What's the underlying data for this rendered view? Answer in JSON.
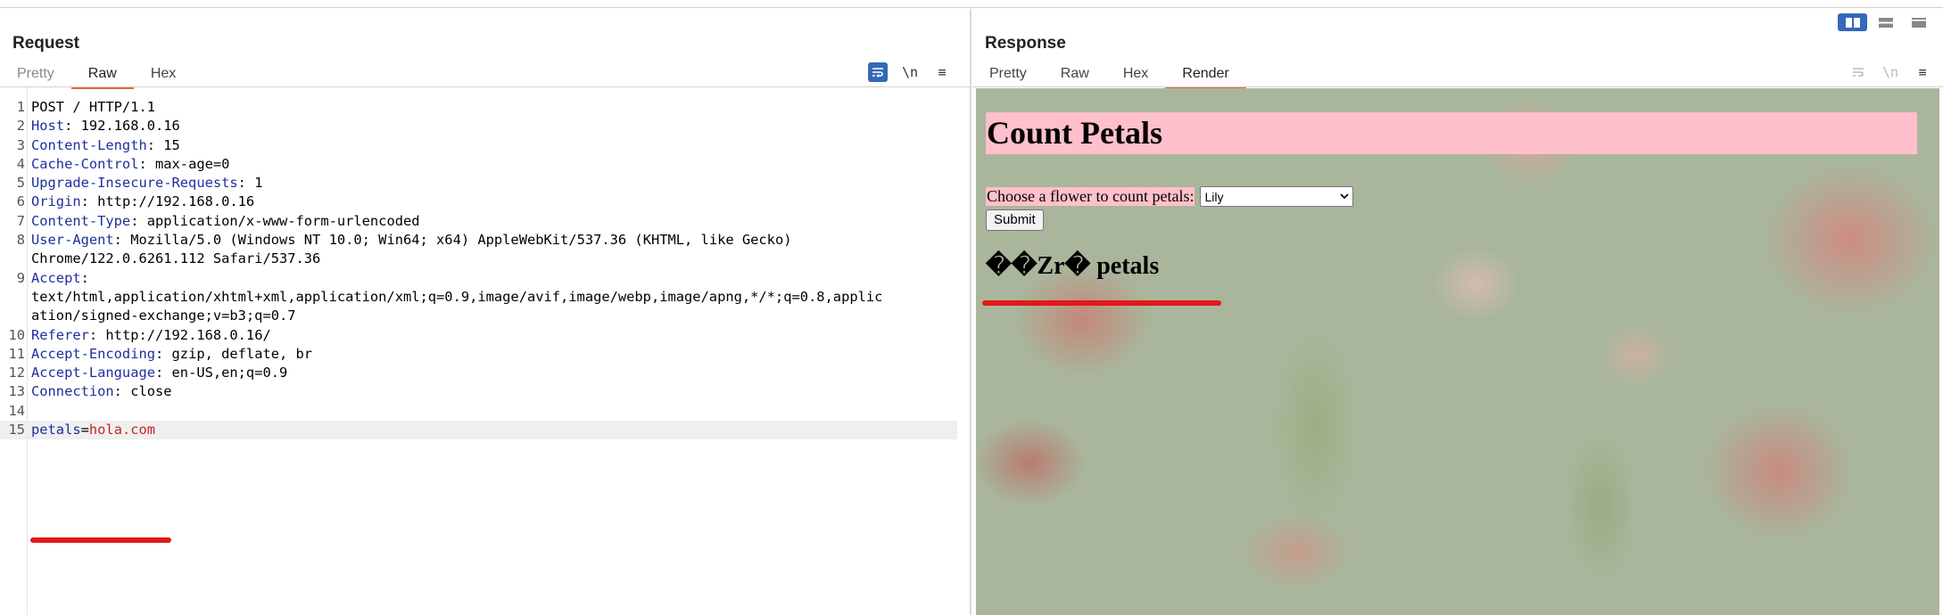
{
  "request": {
    "title": "Request",
    "tabs": [
      {
        "label": "Pretty",
        "state": "disabled"
      },
      {
        "label": "Raw",
        "state": "active"
      },
      {
        "label": "Hex",
        "state": "normal"
      }
    ],
    "icons": {
      "wrap": "wrap-lines-icon",
      "newline": "\\n",
      "menu": "≡"
    },
    "lines": [
      {
        "n": "1",
        "segments": [
          {
            "t": "POST / HTTP/1.1",
            "c": "plain"
          }
        ]
      },
      {
        "n": "2",
        "segments": [
          {
            "t": "Host",
            "c": "key"
          },
          {
            "t": ": 192.168.0.16",
            "c": "plain"
          }
        ]
      },
      {
        "n": "3",
        "segments": [
          {
            "t": "Content-Length",
            "c": "key"
          },
          {
            "t": ": 15",
            "c": "plain"
          }
        ]
      },
      {
        "n": "4",
        "segments": [
          {
            "t": "Cache-Control",
            "c": "key"
          },
          {
            "t": ": max-age=0",
            "c": "plain"
          }
        ]
      },
      {
        "n": "5",
        "segments": [
          {
            "t": "Upgrade-Insecure-Requests",
            "c": "key"
          },
          {
            "t": ": 1",
            "c": "plain"
          }
        ]
      },
      {
        "n": "6",
        "segments": [
          {
            "t": "Origin",
            "c": "key"
          },
          {
            "t": ": http://192.168.0.16",
            "c": "plain"
          }
        ]
      },
      {
        "n": "7",
        "segments": [
          {
            "t": "Content-Type",
            "c": "key"
          },
          {
            "t": ": application/x-www-form-urlencoded",
            "c": "plain"
          }
        ]
      },
      {
        "n": "8",
        "segments": [
          {
            "t": "User-Agent",
            "c": "key"
          },
          {
            "t": ": Mozilla/5.0 (Windows NT 10.0; Win64; x64) AppleWebKit/537.36 (KHTML, like Gecko)",
            "c": "plain"
          }
        ]
      },
      {
        "n": "",
        "segments": [
          {
            "t": "Chrome/122.0.6261.112 Safari/537.36",
            "c": "plain"
          }
        ]
      },
      {
        "n": "9",
        "segments": [
          {
            "t": "Accept",
            "c": "key"
          },
          {
            "t": ":",
            "c": "plain"
          }
        ]
      },
      {
        "n": "",
        "segments": [
          {
            "t": "text/html,application/xhtml+xml,application/xml;q=0.9,image/avif,image/webp,image/apng,*/*;q=0.8,applic",
            "c": "plain"
          }
        ]
      },
      {
        "n": "",
        "segments": [
          {
            "t": "ation/signed-exchange;v=b3;q=0.7",
            "c": "plain"
          }
        ]
      },
      {
        "n": "10",
        "segments": [
          {
            "t": "Referer",
            "c": "key"
          },
          {
            "t": ": http://192.168.0.16/",
            "c": "plain"
          }
        ]
      },
      {
        "n": "11",
        "segments": [
          {
            "t": "Accept-Encoding",
            "c": "key"
          },
          {
            "t": ": gzip, deflate, br",
            "c": "plain"
          }
        ]
      },
      {
        "n": "12",
        "segments": [
          {
            "t": "Accept-Language",
            "c": "key"
          },
          {
            "t": ": en-US,en;q=0.9",
            "c": "plain"
          }
        ]
      },
      {
        "n": "13",
        "segments": [
          {
            "t": "Connection",
            "c": "key"
          },
          {
            "t": ": close",
            "c": "plain"
          }
        ]
      },
      {
        "n": "14",
        "segments": [
          {
            "t": "",
            "c": "plain"
          }
        ]
      },
      {
        "n": "15",
        "segments": [
          {
            "t": "petals",
            "c": "key"
          },
          {
            "t": "=",
            "c": "plain"
          },
          {
            "t": "hola.com",
            "c": "value"
          }
        ],
        "highlight": true
      }
    ]
  },
  "response": {
    "title": "Response",
    "tabs": [
      {
        "label": "Pretty",
        "state": "normal"
      },
      {
        "label": "Raw",
        "state": "normal"
      },
      {
        "label": "Hex",
        "state": "normal"
      },
      {
        "label": "Render",
        "state": "active"
      }
    ],
    "icons": {
      "wrap": "wrap-lines-icon",
      "newline": "\\n",
      "menu": "≡"
    },
    "render": {
      "heading": "Count Petals",
      "form_label": "Choose a flower to count petals:",
      "select_value": "Lily",
      "submit_label": "Submit",
      "result": "��Zr� petals"
    }
  },
  "colors": {
    "active_tab_underline": "#e8692c",
    "toggle_blue": "#3568b8",
    "header_key": "#1e2f9d",
    "param_value": "#c62424",
    "annotation_red": "#e11919",
    "render_heading_bg": "#ffc0cb"
  }
}
